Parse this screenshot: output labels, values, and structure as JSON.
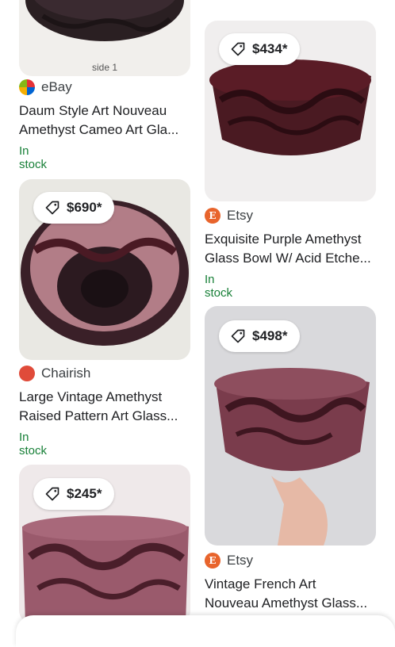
{
  "colors": {
    "stock_green": "#188038",
    "etsy_orange": "#e8642c",
    "chairish_red": "#e04b3a"
  },
  "cards": [
    {
      "store": "eBay",
      "store_icon": "ebay-logo-icon",
      "title_line1": "Daum Style Art Nouveau",
      "title_line2": "Amethyst Cameo Art Gla...",
      "stock": "In stock",
      "image_caption": "side 1"
    },
    {
      "price": "$434*",
      "store": "Etsy",
      "store_icon": "etsy-logo-icon",
      "store_logo_letter": "E",
      "title_line1": "Exquisite Purple Amethyst",
      "title_line2": "Glass Bowl W/ Acid Etche...",
      "stock": "In stock"
    },
    {
      "price": "$690*",
      "store": "Chairish",
      "store_icon": "chairish-logo-icon",
      "title_line1": "Large Vintage Amethyst",
      "title_line2": "Raised Pattern Art Glass...",
      "stock": "In stock"
    },
    {
      "price": "$498*",
      "store": "Etsy",
      "store_icon": "etsy-logo-icon",
      "store_logo_letter": "E",
      "title_line1": "Vintage French Art",
      "title_line2": "Nouveau Amethyst Glass..."
    },
    {
      "price": "$245*"
    }
  ]
}
